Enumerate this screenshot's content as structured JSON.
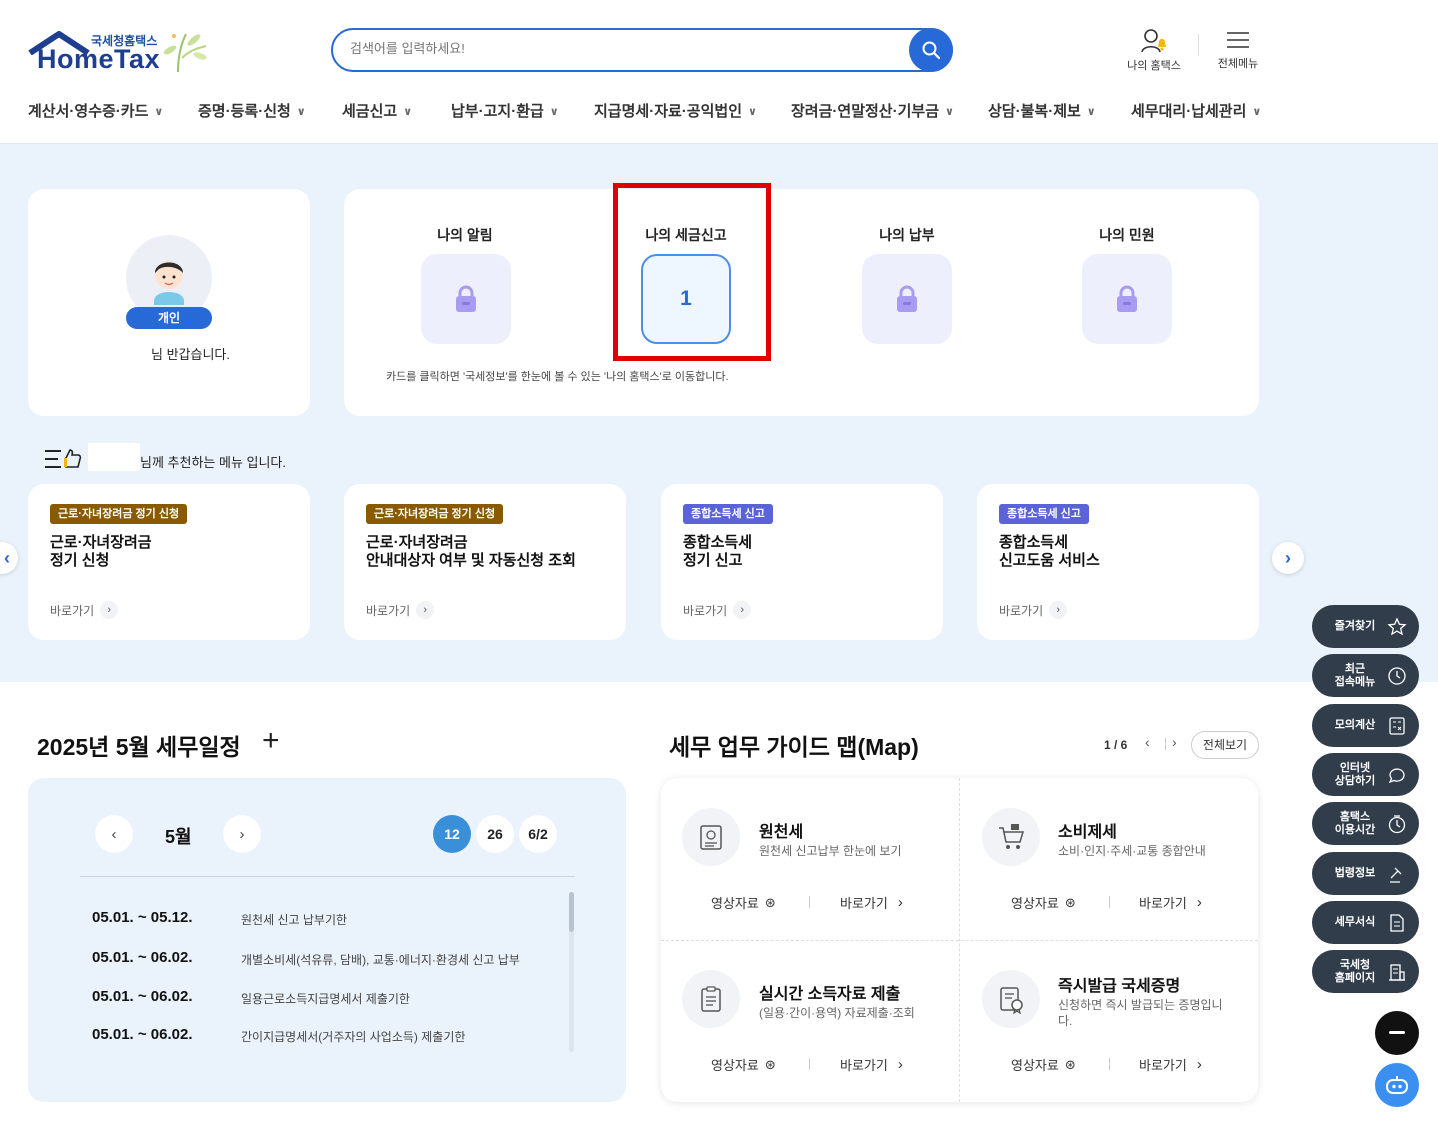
{
  "header": {
    "logo_sub": "국세청홈택스",
    "logo_main": "HomeTax",
    "search_placeholder": "검색어를 입력하세요!",
    "my_hometax": "나의 홈택스",
    "all_menu": "전체메뉴"
  },
  "nav": [
    {
      "label": "계산서·영수증·카드"
    },
    {
      "label": "증명·등록·신청"
    },
    {
      "label": "세금신고"
    },
    {
      "label": "납부·고지·환급"
    },
    {
      "label": "지급명세·자료·공익법인"
    },
    {
      "label": "장려금·연말정산·기부금"
    },
    {
      "label": "상담·불복·제보"
    },
    {
      "label": "세무대리·납세관리"
    }
  ],
  "profile": {
    "badge": "개인",
    "welcome": "님 반갑습니다."
  },
  "my_cards": {
    "items": [
      {
        "title": "나의 알림"
      },
      {
        "title": "나의 세금신고",
        "count": "1"
      },
      {
        "title": "나의 납부"
      },
      {
        "title": "나의 민원"
      }
    ],
    "note": "카드를 클릭하면 '국세정보'를 한눈에 볼 수 있는 '나의 홈택스'로 이동합니다."
  },
  "recommend": {
    "text": "님께 추천하는 메뉴 입니다.",
    "link_label": "바로가기",
    "cards": [
      {
        "tag": "근로·자녀장려금 정기 신청",
        "tag_color": "#8a5a00",
        "line1": "근로·자녀장려금",
        "line2": "정기 신청"
      },
      {
        "tag": "근로·자녀장려금 정기 신청",
        "tag_color": "#8a5a00",
        "line1": "근로·자녀장려금",
        "line2": "안내대상자 여부 및 자동신청 조회"
      },
      {
        "tag": "종합소득세 신고",
        "tag_color": "#5a63d8",
        "line1": "종합소득세",
        "line2": "정기 신고"
      },
      {
        "tag": "종합소득세 신고",
        "tag_color": "#5a63d8",
        "line1": "종합소득세",
        "line2": "신고도움 서비스"
      }
    ]
  },
  "schedule": {
    "title": "2025년 5월 세무일정",
    "month": "5월",
    "days": [
      "12",
      "26",
      "6/2"
    ],
    "rows": [
      {
        "date": "05.01. ~ 05.12.",
        "desc": "원천세 신고 납부기한"
      },
      {
        "date": "05.01. ~ 06.02.",
        "desc": "개별소비세(석유류, 담배), 교통·에너지·환경세 신고 납부"
      },
      {
        "date": "05.01. ~ 06.02.",
        "desc": "일용근로소득지급명세서 제출기한"
      },
      {
        "date": "05.01. ~ 06.02.",
        "desc": "간이지급명세서(거주자의 사업소득) 제출기한"
      }
    ]
  },
  "guide_map": {
    "title": "세무 업무 가이드 맵(Map)",
    "page": "1 / 6",
    "view_all": "전체보기",
    "video_label": "영상자료",
    "go_label": "바로가기",
    "items": [
      {
        "title": "원천세",
        "desc": "원천세 신고납부 한눈에 보기",
        "icon": "receipt-icon"
      },
      {
        "title": "소비제세",
        "desc": "소비·인지·주세·교통 종합안내",
        "icon": "cart-icon"
      },
      {
        "title": "실시간 소득자료 제출",
        "desc": "(일용·간이·용역) 자료제출·조회",
        "icon": "clipboard-icon"
      },
      {
        "title": "즉시발급 국세증명",
        "desc": "신청하면 즉시 발급되는 증명입니다.",
        "icon": "certificate-icon"
      }
    ]
  },
  "quick_menu": [
    {
      "label": "즐겨찾기",
      "icon": "star-icon"
    },
    {
      "label": "최근\n접속메뉴",
      "icon": "clock-icon"
    },
    {
      "label": "모의계산",
      "icon": "calculator-icon"
    },
    {
      "label": "인터넷\n상담하기",
      "icon": "chat-icon"
    },
    {
      "label": "홈택스\n이용시간",
      "icon": "time-icon"
    },
    {
      "label": "법령정보",
      "icon": "law-icon"
    },
    {
      "label": "세무서식",
      "icon": "form-icon"
    },
    {
      "label": "국세청\n홈페이지",
      "icon": "building-icon"
    }
  ],
  "colors": {
    "primary": "#2769d6",
    "band_bg": "#eaf2fb",
    "highlight": "#e00000",
    "quick_bg": "#323d4c"
  }
}
